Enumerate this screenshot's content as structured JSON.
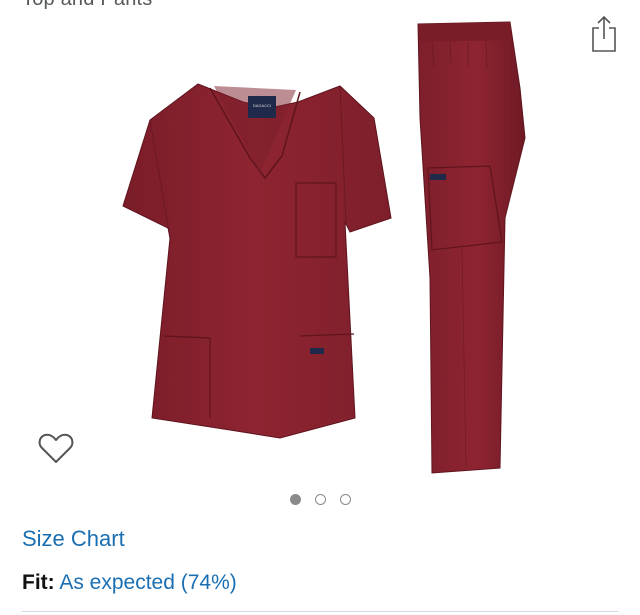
{
  "product": {
    "title_fragment": "Top and Pants",
    "image_alt": "Burgundy scrub set",
    "label_text": "DAGACCI"
  },
  "carousel": {
    "count": 3,
    "active_index": 0
  },
  "links": {
    "size_chart": "Size Chart"
  },
  "fit": {
    "label": "Fit:",
    "value": "As expected (74%)"
  },
  "colors": {
    "scrub": "#8e2431",
    "scrub_dark": "#6b1822",
    "link": "#1a6fb3"
  },
  "icons": {
    "share": "share-icon",
    "wishlist": "heart-outline-icon"
  }
}
